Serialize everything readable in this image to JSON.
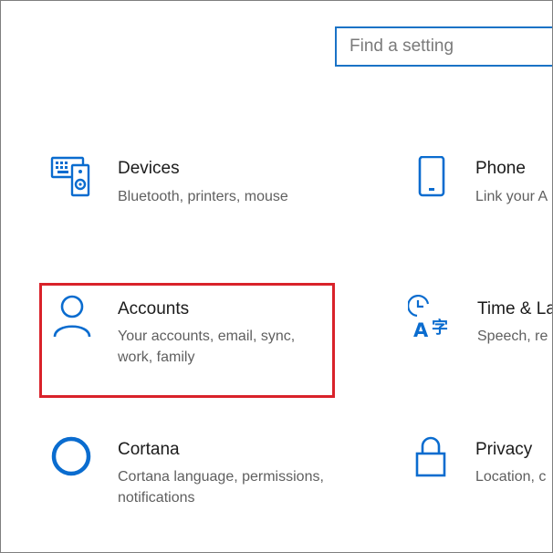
{
  "search": {
    "placeholder": "Find a setting"
  },
  "tiles": [
    {
      "title": "Devices",
      "desc": "Bluetooth, printers, mouse",
      "icon": "devices-icon"
    },
    {
      "title": "Phone",
      "desc": "Link your A",
      "icon": "phone-icon"
    },
    {
      "title": "Accounts",
      "desc": "Your accounts, email, sync, work, family",
      "icon": "person-icon"
    },
    {
      "title": "Time & La",
      "desc": "Speech, re",
      "icon": "time-language-icon"
    },
    {
      "title": "Cortana",
      "desc": "Cortana language, permissions, notifications",
      "icon": "cortana-icon"
    },
    {
      "title": "Privacy",
      "desc": "Location, c",
      "icon": "lock-icon"
    }
  ],
  "colors": {
    "accent": "#0a6ccf",
    "highlight": "#d9222a",
    "search_border": "#1a73c6"
  }
}
